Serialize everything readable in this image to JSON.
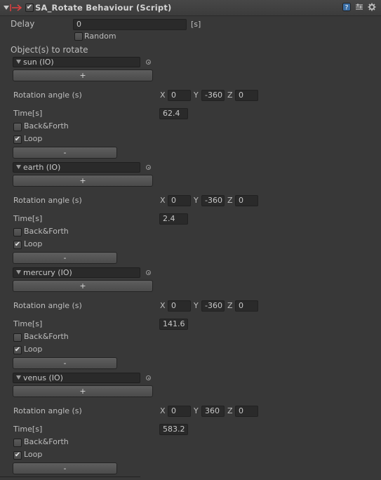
{
  "header": {
    "title": "SA_Rotate Behaviour (Script)",
    "enabled": true
  },
  "delay": {
    "label": "Delay",
    "value": "0",
    "unit": "[s]"
  },
  "random": {
    "label": "Random",
    "checked": false
  },
  "objects_label": "Object(s) to rotate",
  "entries": [
    {
      "object": "sun (IO)",
      "add_label": "+",
      "rotation_label": "Rotation angle (s)",
      "x_label": "X",
      "x": "0",
      "y_label": "Y",
      "y": "-360",
      "z_label": "Z",
      "z": "0",
      "time_label": "Time[s]",
      "time": "62.4",
      "backforth_label": "Back&Forth",
      "backforth": false,
      "loop_label": "Loop",
      "loop": true,
      "remove_label": "-"
    },
    {
      "object": "earth (IO)",
      "add_label": "+",
      "rotation_label": "Rotation angle (s)",
      "x_label": "X",
      "x": "0",
      "y_label": "Y",
      "y": "-360",
      "z_label": "Z",
      "z": "0",
      "time_label": "Time[s]",
      "time": "2.4",
      "backforth_label": "Back&Forth",
      "backforth": false,
      "loop_label": "Loop",
      "loop": true,
      "remove_label": "-"
    },
    {
      "object": "mercury (IO)",
      "add_label": "+",
      "rotation_label": "Rotation angle (s)",
      "x_label": "X",
      "x": "0",
      "y_label": "Y",
      "y": "-360",
      "z_label": "Z",
      "z": "0",
      "time_label": "Time[s]",
      "time": "141.6",
      "backforth_label": "Back&Forth",
      "backforth": false,
      "loop_label": "Loop",
      "loop": true,
      "remove_label": "-"
    },
    {
      "object": "venus (IO)",
      "add_label": "+",
      "rotation_label": "Rotation angle (s)",
      "x_label": "X",
      "x": "0",
      "y_label": "Y",
      "y": "360",
      "z_label": "Z",
      "z": "0",
      "time_label": "Time[s]",
      "time": "583.2",
      "backforth_label": "Back&Forth",
      "backforth": false,
      "loop_label": "Loop",
      "loop": true,
      "remove_label": "-"
    }
  ],
  "icons": {
    "foldout": "foldout-arrow-icon",
    "script": "script-icon",
    "help": "help-icon",
    "presets": "presets-icon",
    "settings": "gear-icon",
    "object": "gameobject-icon",
    "picker": "object-picker-icon"
  },
  "colors": {
    "background": "#383838",
    "accent": "#e04040"
  }
}
